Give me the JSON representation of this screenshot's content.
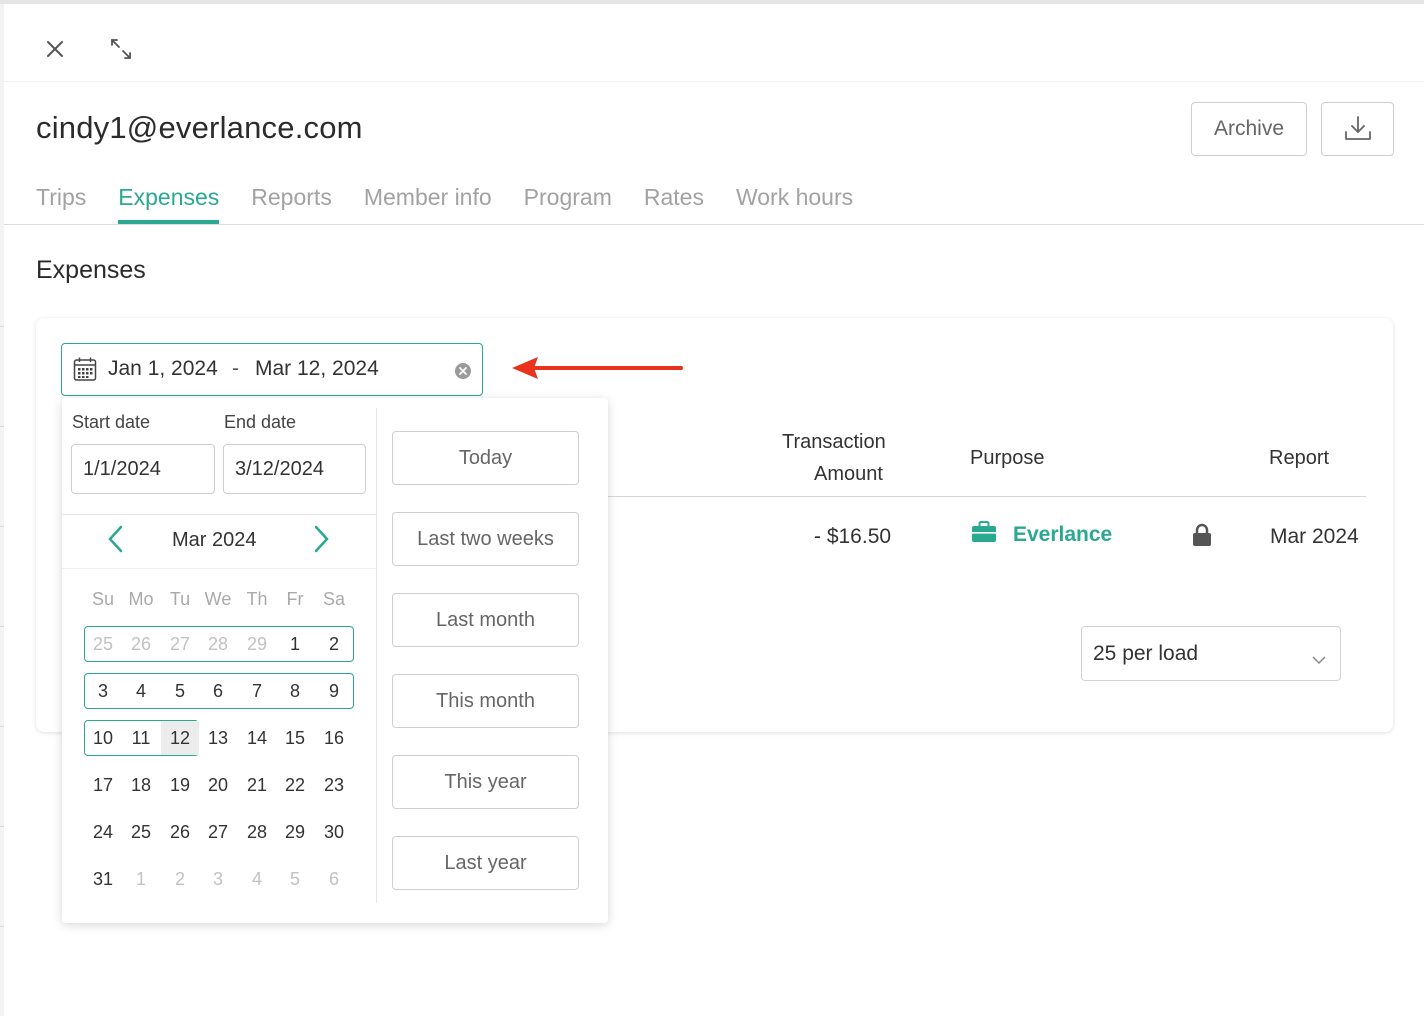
{
  "window": {
    "close_icon": "close-icon",
    "expand_icon": "expand-icon"
  },
  "header": {
    "title": "cindy1@everlance.com",
    "archive_label": "Archive",
    "download_icon": "download-icon"
  },
  "tabs": [
    {
      "label": "Trips",
      "active": false
    },
    {
      "label": "Expenses",
      "active": true
    },
    {
      "label": "Reports",
      "active": false
    },
    {
      "label": "Member info",
      "active": false
    },
    {
      "label": "Program",
      "active": false
    },
    {
      "label": "Rates",
      "active": false
    },
    {
      "label": "Work hours",
      "active": false
    }
  ],
  "section": {
    "title": "Expenses"
  },
  "date_range": {
    "start": "Jan 1, 2024",
    "separator": "-",
    "end": "Mar 12, 2024"
  },
  "table": {
    "headers": {
      "amount_line1": "Transaction",
      "amount_line2": "Amount",
      "purpose": "Purpose",
      "report": "Report"
    },
    "rows": [
      {
        "amount": "- $16.50",
        "purpose": "Everlance",
        "locked": true,
        "report": "Mar 2024"
      }
    ]
  },
  "pagination": {
    "per_load": "25 per load"
  },
  "picker": {
    "start_label": "Start date",
    "end_label": "End date",
    "start_value": "1/1/2024",
    "end_value": "3/12/2024",
    "month_label": "Mar 2024",
    "weekdays": [
      "Su",
      "Mo",
      "Tu",
      "We",
      "Th",
      "Fr",
      "Sa"
    ],
    "weeks": [
      [
        "25",
        "26",
        "27",
        "28",
        "29",
        "1",
        "2"
      ],
      [
        "3",
        "4",
        "5",
        "6",
        "7",
        "8",
        "9"
      ],
      [
        "10",
        "11",
        "12",
        "13",
        "14",
        "15",
        "16"
      ],
      [
        "17",
        "18",
        "19",
        "20",
        "21",
        "22",
        "23"
      ],
      [
        "24",
        "25",
        "26",
        "27",
        "28",
        "29",
        "30"
      ],
      [
        "31",
        "1",
        "2",
        "3",
        "4",
        "5",
        "6"
      ]
    ],
    "presets": [
      "Today",
      "Last two weeks",
      "Last month",
      "This month",
      "This year",
      "Last year"
    ]
  },
  "colors": {
    "accent": "#2aa891",
    "arrow": "#e8321e"
  }
}
